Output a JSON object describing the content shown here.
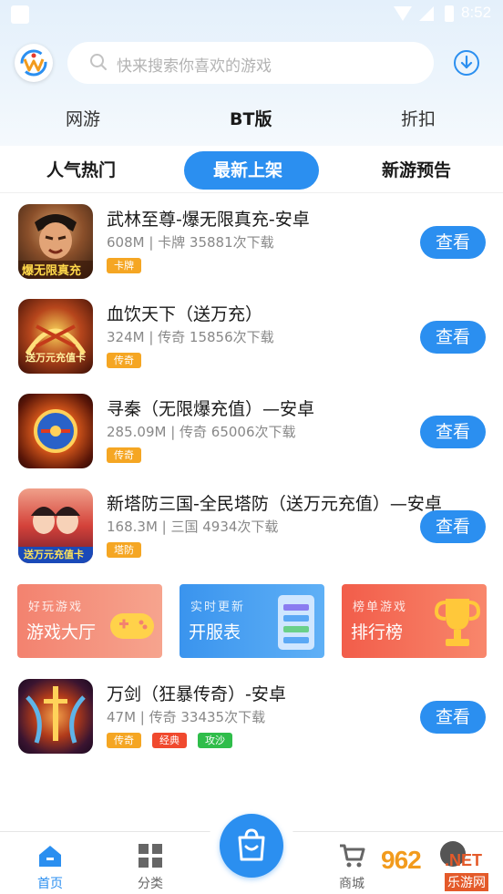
{
  "status_bar": {
    "time": "8:52"
  },
  "search": {
    "placeholder": "快来搜索你喜欢的游戏"
  },
  "top_tabs": [
    {
      "label": "网游",
      "active": false
    },
    {
      "label": "BT版",
      "active": true
    },
    {
      "label": "折扣",
      "active": false
    }
  ],
  "sub_tabs": [
    {
      "label": "人气热门",
      "active": false
    },
    {
      "label": "最新上架",
      "active": true
    },
    {
      "label": "新游预告",
      "active": false
    }
  ],
  "games": [
    {
      "title": "武林至尊-爆无限真充-安卓",
      "meta": "608M | 卡牌  35881次下载",
      "tags": [
        "卡牌"
      ],
      "button": "查看",
      "icon": "warrior-game-icon"
    },
    {
      "title": "血饮天下（送万充）",
      "meta": "324M | 传奇  15856次下载",
      "tags": [
        "传奇"
      ],
      "button": "查看",
      "icon": "legend-game-icon"
    },
    {
      "title": "寻秦（无限爆充值）—安卓",
      "meta": "285.09M | 传奇  65006次下载",
      "tags": [
        "传奇"
      ],
      "button": "查看",
      "icon": "orb-game-icon"
    },
    {
      "title": "新塔防三国-全民塔防（送万元充值）—安卓",
      "meta": "168.3M | 三国  4934次下载",
      "tags": [
        "塔防"
      ],
      "button": "查看",
      "icon": "three-kingdoms-game-icon"
    },
    {
      "title": "万剑（狂暴传奇）-安卓",
      "meta": "47M | 传奇  33435次下载",
      "tags": [
        "传奇",
        "经典",
        "攻沙"
      ],
      "button": "查看",
      "icon": "sword-game-icon"
    }
  ],
  "game_overlay_text": {
    "game_1": "爆无限真充",
    "game_2": "送万元充值卡",
    "game_4": "送万元充值卡"
  },
  "banners": [
    {
      "sub": "好玩游戏",
      "main": "游戏大厅",
      "color": "#f47a6b",
      "icon": "gamepad-icon"
    },
    {
      "sub": "实时更新",
      "main": "开服表",
      "color": "#3d9af0",
      "icon": "server-list-icon"
    },
    {
      "sub": "榜单游戏",
      "main": "排行榜",
      "color": "#f26a56",
      "icon": "trophy-icon"
    }
  ],
  "bottom_nav": [
    {
      "label": "首页",
      "icon": "home-icon",
      "active": true
    },
    {
      "label": "分类",
      "icon": "grid-icon",
      "active": false
    },
    {
      "label": "商城",
      "icon": "cart-icon",
      "active": false
    }
  ],
  "watermark": {
    "brand": "962",
    "suffix": ".NET",
    "site": "乐游网"
  },
  "colors": {
    "accent": "#2b8ff0",
    "tag_orange": "#f5a623",
    "tag_red": "#f0492e",
    "tag_green": "#2fbd4a"
  }
}
